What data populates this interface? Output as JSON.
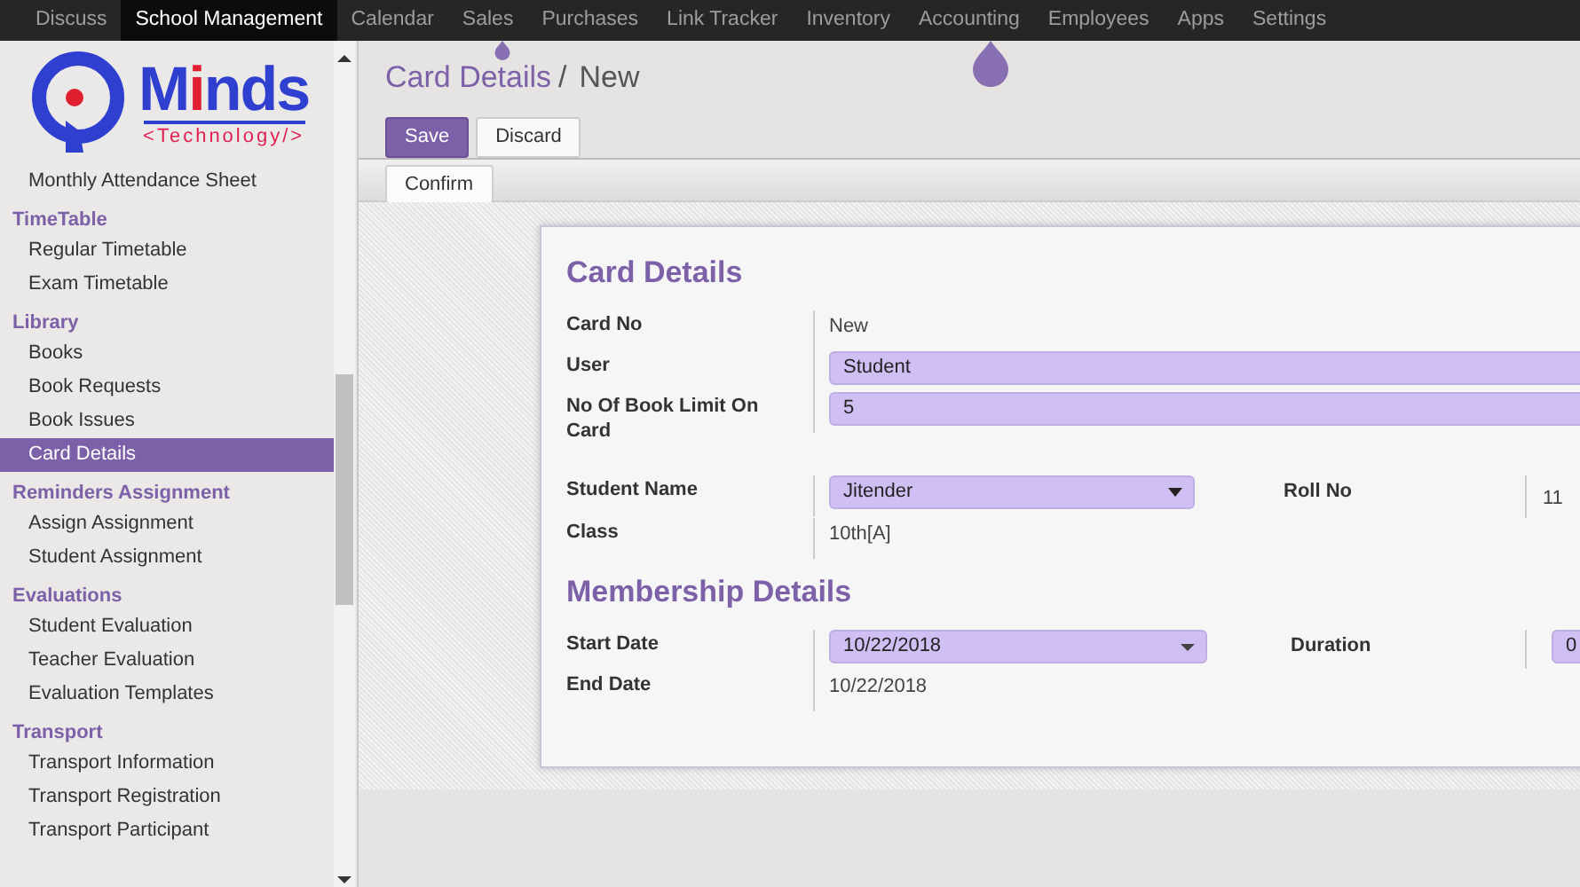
{
  "top_menu": [
    {
      "label": "Discuss",
      "selected": false
    },
    {
      "label": "School Management",
      "selected": true
    },
    {
      "label": "Calendar",
      "selected": false
    },
    {
      "label": "Sales",
      "selected": false
    },
    {
      "label": "Purchases",
      "selected": false
    },
    {
      "label": "Link Tracker",
      "selected": false
    },
    {
      "label": "Inventory",
      "selected": false
    },
    {
      "label": "Accounting",
      "selected": false
    },
    {
      "label": "Employees",
      "selected": false
    },
    {
      "label": "Apps",
      "selected": false
    },
    {
      "label": "Settings",
      "selected": false
    }
  ],
  "logo": {
    "name": "Minds",
    "tagline": "<Technology/>"
  },
  "sidebar": {
    "items": [
      {
        "kind": "item",
        "label": "Monthly Attendance Sheet",
        "selected": false
      },
      {
        "kind": "header",
        "label": "TimeTable"
      },
      {
        "kind": "item",
        "label": "Regular Timetable",
        "selected": false
      },
      {
        "kind": "item",
        "label": "Exam Timetable",
        "selected": false
      },
      {
        "kind": "header",
        "label": "Library"
      },
      {
        "kind": "item",
        "label": "Books",
        "selected": false
      },
      {
        "kind": "item",
        "label": "Book Requests",
        "selected": false
      },
      {
        "kind": "item",
        "label": "Book Issues",
        "selected": false
      },
      {
        "kind": "item",
        "label": "Card Details",
        "selected": true
      },
      {
        "kind": "header",
        "label": "Reminders Assignment"
      },
      {
        "kind": "item",
        "label": "Assign Assignment",
        "selected": false
      },
      {
        "kind": "item",
        "label": "Student Assignment",
        "selected": false
      },
      {
        "kind": "header",
        "label": "Evaluations"
      },
      {
        "kind": "item",
        "label": "Student Evaluation",
        "selected": false
      },
      {
        "kind": "item",
        "label": "Teacher Evaluation",
        "selected": false
      },
      {
        "kind": "item",
        "label": "Evaluation Templates",
        "selected": false
      },
      {
        "kind": "header",
        "label": "Transport"
      },
      {
        "kind": "item",
        "label": "Transport Information",
        "selected": false
      },
      {
        "kind": "item",
        "label": "Transport Registration",
        "selected": false
      },
      {
        "kind": "item",
        "label": "Transport Participant",
        "selected": false
      }
    ]
  },
  "breadcrumb": {
    "parent": "Card Details",
    "separator": "/",
    "current": "New"
  },
  "buttons": {
    "save": "Save",
    "discard": "Discard",
    "confirm": "Confirm"
  },
  "form": {
    "sections": [
      {
        "title": "Card Details",
        "rows": [
          {
            "kind": "text",
            "label": "Card No",
            "value": "New"
          },
          {
            "kind": "input",
            "label": "User",
            "value": "Student"
          },
          {
            "kind": "input",
            "label": "No Of Book Limit On Card",
            "value": "5"
          }
        ]
      },
      {
        "rows": [
          {
            "kind": "select",
            "label": "Student Name",
            "value": "Jitender",
            "side_label": "Roll No",
            "side_value": "11"
          },
          {
            "kind": "text",
            "label": "Class",
            "value": "10th[A]"
          }
        ]
      },
      {
        "title": "Membership Details",
        "rows": [
          {
            "kind": "date",
            "label": "Start Date",
            "value": "10/22/2018",
            "side_label": "Duration",
            "side_input": "0"
          },
          {
            "kind": "text",
            "label": "End Date",
            "value": "10/22/2018"
          }
        ]
      }
    ]
  }
}
